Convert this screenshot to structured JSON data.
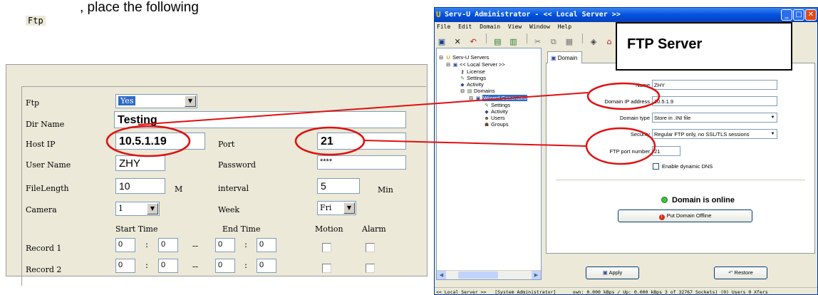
{
  "caption": ", place the following",
  "ftp_panel": {
    "group_title": "Ftp",
    "ftp_label": "Ftp",
    "ftp_value": "Yes",
    "dir_name_label": "Dir Name",
    "dir_name_value": "Testing",
    "host_ip_label": "Host IP",
    "host_ip_value": "10.5.1.19",
    "port_label": "Port",
    "port_value": "21",
    "user_name_label": "User Name",
    "user_name_value": "ZHY",
    "password_label": "Password",
    "password_value": "****",
    "file_length_label": "FileLength",
    "file_length_value": "10",
    "file_length_unit": "M",
    "interval_label": "interval",
    "interval_value": "5",
    "interval_unit": "Min",
    "camera_label": "Camera",
    "camera_value": "1",
    "week_label": "Week",
    "week_value": "Fri",
    "start_time_header": "Start Time",
    "end_time_header": "End Time",
    "motion_header": "Motion",
    "alarm_header": "Alarm",
    "record1_label": "Record 1",
    "record2_label": "Record 2",
    "time_zero": "0",
    "colon": ":",
    "dash": "--"
  },
  "servu": {
    "title": "Serv-U Administrator - << Local Server >>",
    "menu": [
      "File",
      "Edit",
      "Domain",
      "View",
      "Window",
      "Help"
    ],
    "tree": {
      "root": "Serv-U Servers",
      "local_server": "<< Local Server >>",
      "license": "License",
      "settings": "Settings",
      "activity": "Activity",
      "domains": "Domains",
      "wizard": "Wizard Generated",
      "wizard_settings": "Settings",
      "wizard_activity": "Activity",
      "users": "Users",
      "groups": "Groups"
    },
    "tab_label": "Domain",
    "name_label": "Name",
    "name_value": "ZHY",
    "ip_label": "Domain IP address",
    "ip_value": "10.5.1.9",
    "type_label": "Domain type",
    "type_value": "Store in .INI file",
    "security_label": "Security",
    "security_value": "Regular FTP only, no SSL/TLS sessions",
    "port_label": "FTP port number",
    "port_value": "21",
    "dynamic_dns_label": "Enable dynamic DNS",
    "online_status": "Domain is online",
    "offline_button": "Put Domain Offline",
    "apply_button": "Apply",
    "restore_button": "Restore",
    "status_left": "<< Local Server >>",
    "status_user": "[System Administrator]",
    "status_right": "own: 0.000 kBps / Up: 0.000 kBps 3 of 32767 Sockets) (0) Users 0 Xfers"
  },
  "ftp_server_callout": "FTP Server",
  "colors": {
    "annotation_red": "#e01010",
    "xp_titlebar_blue": "#0050e0",
    "selection_blue": "#316ac5",
    "online_green": "#3ec43e"
  }
}
